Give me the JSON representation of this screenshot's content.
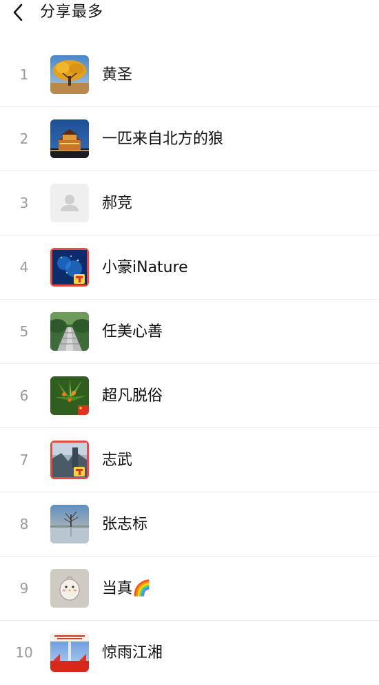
{
  "header": {
    "title": "分享最多",
    "back_icon": "chevron-left-icon"
  },
  "rows": [
    {
      "rank": "1",
      "name": "黄圣",
      "avatar": "avatar-golden-tree"
    },
    {
      "rank": "2",
      "name": "一匹来自北方的狼",
      "avatar": "avatar-night-tower"
    },
    {
      "rank": "3",
      "name": "郝竞",
      "avatar": "avatar-default-person-icon"
    },
    {
      "rank": "4",
      "name": "小豪iNature",
      "avatar": "avatar-blue-70-badge"
    },
    {
      "rank": "5",
      "name": "任美心善",
      "avatar": "avatar-bridge-path"
    },
    {
      "rank": "6",
      "name": "超凡脱俗",
      "avatar": "avatar-plant-flag"
    },
    {
      "rank": "7",
      "name": "志武",
      "avatar": "avatar-mountain-70-badge"
    },
    {
      "rank": "8",
      "name": "张志标",
      "avatar": "avatar-lake-tree"
    },
    {
      "rank": "9",
      "name": "当真🌈",
      "avatar": "avatar-cartoon-chick"
    },
    {
      "rank": "10",
      "name": "惊雨江湘",
      "avatar": "avatar-red-flags-poster"
    }
  ]
}
